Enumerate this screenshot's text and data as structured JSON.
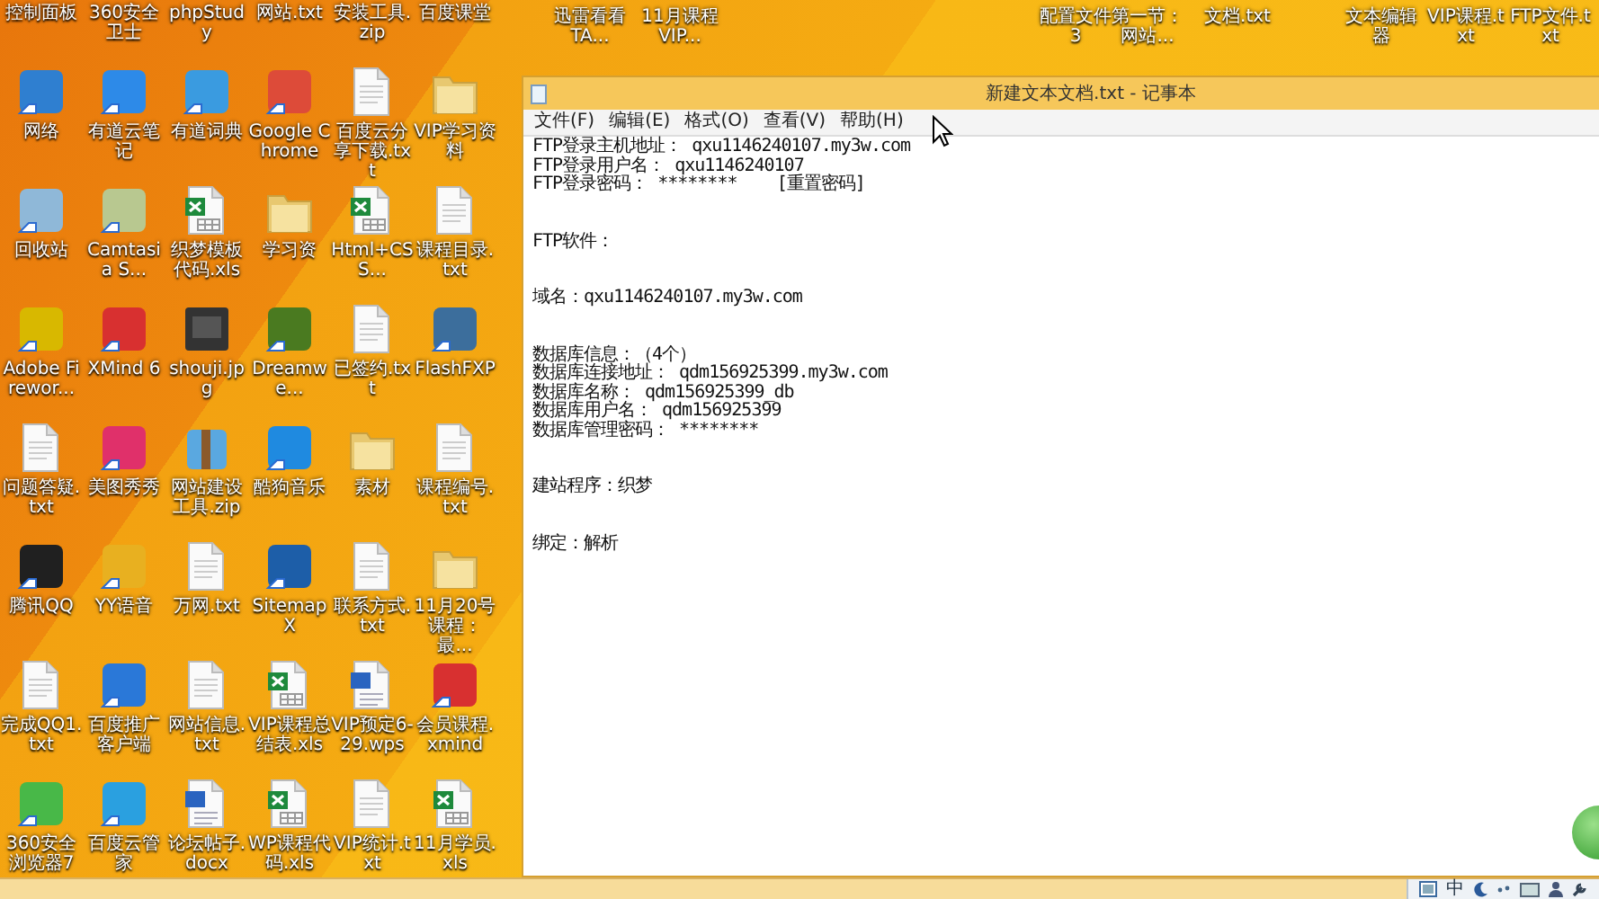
{
  "desktop": {
    "icons": [
      {
        "label": "控制面板"
      },
      {
        "label": "360安全卫士"
      },
      {
        "label": "phpStudy"
      },
      {
        "label": "网站.txt"
      },
      {
        "label": "安装工具.zip"
      },
      {
        "label": "百度课堂"
      },
      {
        "label": "网络",
        "kind": "app",
        "color": "#2f7fd0"
      },
      {
        "label": "有道云笔记",
        "kind": "app",
        "color": "#2d8ae8"
      },
      {
        "label": "有道词典",
        "kind": "app",
        "color": "#3a9be0"
      },
      {
        "label": "Google Chrome",
        "kind": "app",
        "color": "#dd4b39"
      },
      {
        "label": "百度云分享下载.txt",
        "kind": "file"
      },
      {
        "label": "VIP学习资料",
        "kind": "folder"
      },
      {
        "label": "回收站",
        "kind": "app",
        "color": "#8fb8d8"
      },
      {
        "label": "Camtasia S...",
        "kind": "app",
        "color": "#b8c890"
      },
      {
        "label": "织梦模板代码.xls",
        "kind": "sheet"
      },
      {
        "label": "学习资",
        "kind": "folder"
      },
      {
        "label": "Html+CSS...",
        "kind": "sheet"
      },
      {
        "label": "课程目录.txt",
        "kind": "file"
      },
      {
        "label": "Adobe Firewor...",
        "kind": "app",
        "color": "#d8b800"
      },
      {
        "label": "XMind 6",
        "kind": "app",
        "color": "#d83030"
      },
      {
        "label": "shouji.jpg",
        "kind": "image"
      },
      {
        "label": "Dreamwe...",
        "kind": "app",
        "color": "#4a7a20"
      },
      {
        "label": "已签约.txt",
        "kind": "file"
      },
      {
        "label": "FlashFXP",
        "kind": "app",
        "color": "#3c6e9c"
      },
      {
        "label": "问题答疑.txt",
        "kind": "file"
      },
      {
        "label": "美图秀秀",
        "kind": "app",
        "color": "#e0306a"
      },
      {
        "label": "网站建设工具.zip",
        "kind": "archive"
      },
      {
        "label": "酷狗音乐",
        "kind": "app",
        "color": "#1f8ae0"
      },
      {
        "label": "素材",
        "kind": "folder"
      },
      {
        "label": "课程编号.txt",
        "kind": "file"
      },
      {
        "label": "腾讯QQ",
        "kind": "app",
        "color": "#202020"
      },
      {
        "label": "YY语音",
        "kind": "app",
        "color": "#e8b020"
      },
      {
        "label": "万网.txt",
        "kind": "file"
      },
      {
        "label": "SitemapX",
        "kind": "app",
        "color": "#1d5ea8"
      },
      {
        "label": "联系方式.txt",
        "kind": "file"
      },
      {
        "label": "11月20号课程：最...",
        "kind": "folder"
      },
      {
        "label": "完成QQ1.txt",
        "kind": "file"
      },
      {
        "label": "百度推广客户端",
        "kind": "app",
        "color": "#2a78d8"
      },
      {
        "label": "网站信息.txt",
        "kind": "file"
      },
      {
        "label": "VIP课程总结表.xls",
        "kind": "sheet"
      },
      {
        "label": "VIP预定6-29.wps",
        "kind": "doc"
      },
      {
        "label": "会员课程.xmind",
        "kind": "app",
        "color": "#d83030"
      },
      {
        "label": "360安全浏览器7",
        "kind": "app",
        "color": "#48b848"
      },
      {
        "label": "百度云管家",
        "kind": "app",
        "color": "#2aa0e0"
      },
      {
        "label": "论坛帖子.docx",
        "kind": "doc"
      },
      {
        "label": "WP课程代码.xls",
        "kind": "sheet"
      },
      {
        "label": "VIP统计.txt",
        "kind": "file"
      },
      {
        "label": "11月学员.xls",
        "kind": "sheet"
      }
    ],
    "top_icons": [
      {
        "label": "迅雷看看TA..."
      },
      {
        "label": "11月课程VIP..."
      },
      {
        "label": "配置文件3"
      },
      {
        "label": "第一节：网站..."
      },
      {
        "label": "文档.txt"
      },
      {
        "label": "文本编辑器"
      },
      {
        "label": "VIP课程.txt"
      },
      {
        "label": "FTP文件.txt"
      }
    ]
  },
  "notepad": {
    "title": "新建文本文档.txt - 记事本",
    "menu": [
      "文件(F)",
      "编辑(E)",
      "格式(O)",
      "查看(V)",
      "帮助(H)"
    ],
    "blocks": [
      [
        "FTP登录主机地址： qxu1146240107.my3w.com",
        "FTP登录用户名： qxu1146240107",
        "FTP登录密码： ********    [重置密码]"
      ],
      [
        "FTP软件："
      ],
      [
        "域名：qxu1146240107.my3w.com"
      ],
      [
        "数据库信息：（4个）",
        "数据库连接地址： qdm156925399.my3w.com",
        "数据库名称： qdm156925399_db",
        "数据库用户名： qdm156925399",
        "数据库管理密码： ********"
      ],
      [
        "建站程序：织梦"
      ],
      [
        "绑定：解析"
      ]
    ]
  },
  "tray": {
    "ime_label": "中"
  }
}
